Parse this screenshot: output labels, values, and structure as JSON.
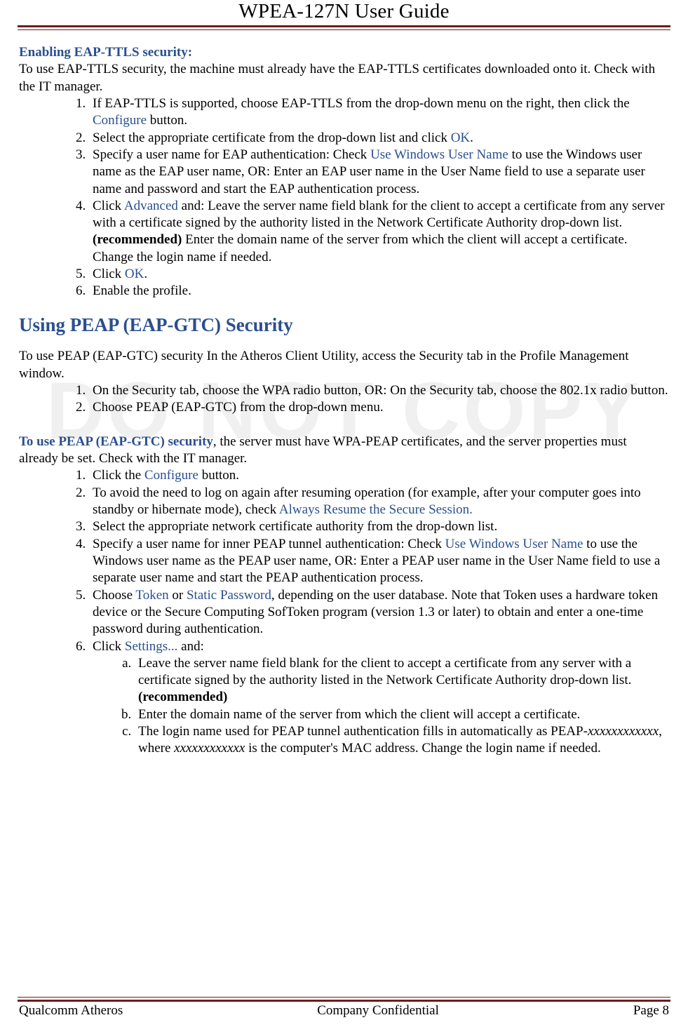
{
  "header": {
    "title": "WPEA-127N User Guide"
  },
  "watermark": "DO NOT COPY",
  "section1": {
    "heading": "Enabling EAP-TTLS security:",
    "intro": "To use EAP-TTLS security, the machine must already have the EAP-TTLS certificates downloaded onto it. Check with the IT manager.",
    "items": [
      {
        "pre": "If EAP-TTLS is supported, choose EAP-TTLS from the drop-down menu on the right, then click the ",
        "link": "Configure",
        "post": " button."
      },
      {
        "pre": "Select the appropriate certificate from the drop-down list and click ",
        "link": "OK",
        "post": "."
      },
      {
        "pre": "Specify a user name for EAP authentication: Check ",
        "link": "Use Windows User Name",
        "post": " to use the Windows user name as the EAP user name, OR: Enter an EAP user name in the User Name field to use a separate user name and password and start the EAP authentication process."
      },
      {
        "pre": "Click ",
        "link": "Advanced",
        "mid": " and: Leave the server name field blank for the client to accept a certificate from any server with a certificate signed by the authority listed in the Network Certificate Authority drop-down list. ",
        "bold": "(recommended)",
        "post": "  Enter the domain name of the server from which the client will accept a certificate. Change the login name if needed."
      },
      {
        "pre": "Click ",
        "link": "OK",
        "post": "."
      },
      {
        "plain": "Enable the profile."
      }
    ]
  },
  "section2": {
    "heading": "Using PEAP (EAP-GTC) Security",
    "intro": "To use PEAP (EAP-GTC) security In the Atheros Client Utility, access the Security tab in the Profile Management window.",
    "items": [
      "On the Security tab, choose the WPA radio button, OR: On the Security tab, choose the 802.1x radio button.",
      "Choose PEAP (EAP-GTC) from the drop-down menu."
    ]
  },
  "section3": {
    "heading": "To use PEAP (EAP-GTC) security",
    "intro_post": ", the server must have WPA-PEAP certificates, and the server properties must already be set. Check with the IT manager.",
    "items": {
      "i1": {
        "pre": "Click the ",
        "link": "Configure",
        "post": " button."
      },
      "i2": {
        "pre": "To avoid the need to log on again after resuming operation (for example, after your computer goes into standby or hibernate mode), check ",
        "link": "Always Resume the Secure Session."
      },
      "i3": "Select the appropriate network certificate authority from the drop-down list.",
      "i4": {
        "pre": "Specify a user name for inner PEAP tunnel authentication: Check ",
        "link": "Use Windows User Name",
        "post": " to use the Windows user name as the PEAP user name, OR: Enter a PEAP user name in the User Name field to use a separate user name and start the PEAP authentication process."
      },
      "i5": {
        "pre": "Choose ",
        "link1": "Token",
        "mid": " or ",
        "link2": "Static Password",
        "post": ", depending on the user database. Note that Token uses a hardware token device or the Secure Computing SofToken program (version 1.3 or later) to obtain and enter a one-time password during authentication."
      },
      "i6": {
        "pre": "Click ",
        "link": "Settings...",
        "post": " and:"
      }
    },
    "sub": {
      "a": {
        "pre": "Leave the server name field blank for the client to accept a certificate from any server with a certificate signed by the authority listed in the Network Certificate Authority drop-down list. ",
        "bold": "(recommended)"
      },
      "b": "Enter the domain name of the server from which the client will accept a certificate.",
      "c": {
        "pre": "The login name used for PEAP tunnel authentication fills in automatically as PEAP-",
        "it1": "xxxxxxxxxxxx",
        "mid": ", where ",
        "it2": "xxxxxxxxxxxx",
        "post": " is the computer's MAC address. Change the login name if needed."
      }
    }
  },
  "footer": {
    "left": "Qualcomm Atheros",
    "center": "Company Confidential",
    "right": "Page 8"
  }
}
